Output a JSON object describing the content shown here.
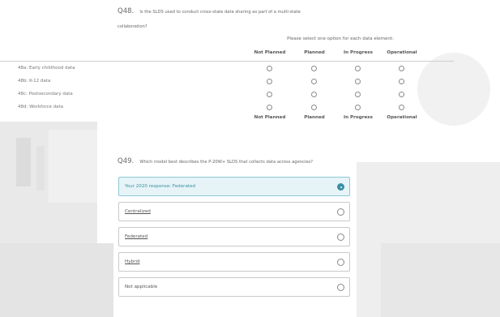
{
  "q48": {
    "number": "Q48.",
    "text_line1": "Is the SLDS used to conduct cross-state data sharing as part of a multi-state",
    "text_line2": "collaboration?"
  },
  "matrix": {
    "instruction": "Please select one option for each data element:",
    "columns": [
      "Not Planned",
      "Planned",
      "In Progress",
      "Operational"
    ],
    "rows": [
      {
        "label": "48a: Early childhood data"
      },
      {
        "label": "48b: K-12 data"
      },
      {
        "label": "48c: Postsecondary data"
      },
      {
        "label": "48d: Workforce data"
      }
    ]
  },
  "q49": {
    "number": "Q49.",
    "text": "Which model best describes the P-20W+ SLDS that collects data across agencies?",
    "options": [
      {
        "label": "Your 2020 response: Federated",
        "selected": true
      },
      {
        "label": "Centralized",
        "selected": false
      },
      {
        "label": "Federated",
        "selected": false
      },
      {
        "label": "Hybrid",
        "selected": false
      },
      {
        "label": "Not applicable",
        "selected": false
      }
    ]
  },
  "colors": {
    "accent": "#3a8fa5",
    "selected_bg": "#e6f4f7",
    "border": "#c9c9c9"
  }
}
